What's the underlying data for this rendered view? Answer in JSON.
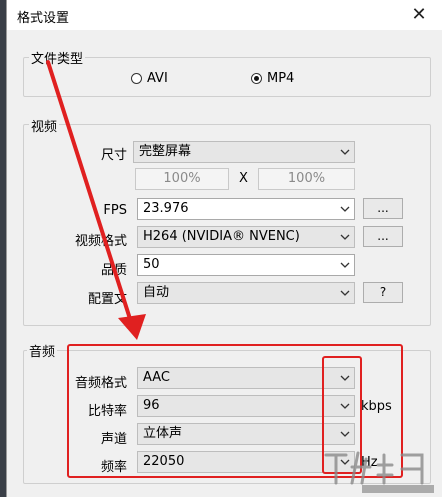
{
  "window": {
    "title": "格式设置",
    "close_glyph": "✕"
  },
  "file_type": {
    "legend": "文件类型",
    "options": [
      {
        "label": "AVI",
        "selected": false
      },
      {
        "label": "MP4",
        "selected": true
      }
    ]
  },
  "video": {
    "legend": "视频",
    "size_label": "尺寸",
    "size_value": "完整屏幕",
    "width_pct": "100%",
    "times": "X",
    "height_pct": "100%",
    "fps_label": "FPS",
    "fps_value": "23.976",
    "fps_more": "...",
    "codec_label": "视频格式",
    "codec_value": "H264 (NVIDIA® NVENC)",
    "codec_more": "...",
    "quality_label": "品质",
    "quality_value": "50",
    "profile_label": "配置文",
    "profile_value": "自动",
    "profile_help": "?"
  },
  "audio": {
    "legend": "音频",
    "format_label": "音频格式",
    "format_value": "AAC",
    "bitrate_label": "比特率",
    "bitrate_value": "96",
    "bitrate_unit": "kbps",
    "channel_label": "声道",
    "channel_value": "立体声",
    "samplerate_label": "频率",
    "samplerate_value": "22050",
    "samplerate_unit": "Hz"
  },
  "annotation_color": "#e02020",
  "icons": {
    "dropdown": "chevron-down-icon",
    "close": "close-icon"
  }
}
